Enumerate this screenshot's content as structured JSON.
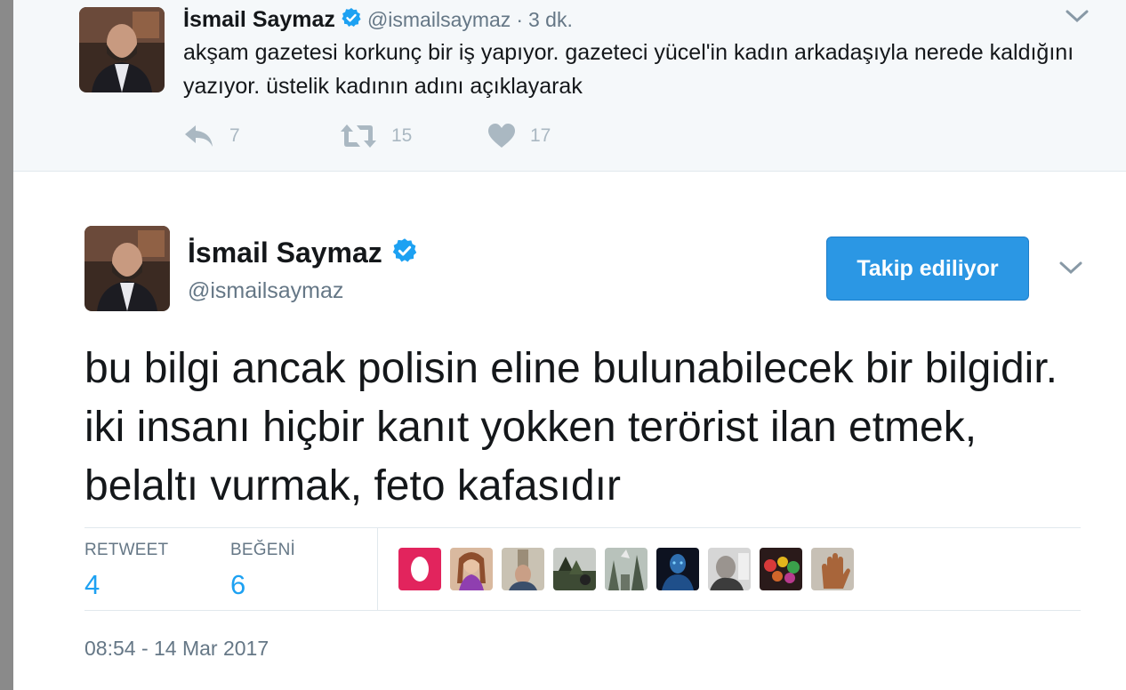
{
  "parent_tweet": {
    "name": "İsmail Saymaz",
    "handle": "@ismailsaymaz",
    "separator": "·",
    "time": "3 dk.",
    "text": "akşam gazetesi korkunç bir iş yapıyor. gazeteci yücel'in kadın arkadaşıyla nerede kaldığını yazıyor. üstelik kadının adını açıklayarak",
    "reply_count": "7",
    "retweet_count": "15",
    "like_count": "17"
  },
  "main_tweet": {
    "name": "İsmail Saymaz",
    "handle": "@ismailsaymaz",
    "follow_button": "Takip ediliyor",
    "text": "bu bilgi ancak polisin eline bulunabilecek bir bilgidir. iki insanı hiçbir kanıt yokken terörist ilan etmek, belaltı vurmak, feto kafasıdır",
    "retweet_label": "RETWEET",
    "retweet_count": "4",
    "like_label": "BEĞENİ",
    "like_count": "6",
    "timestamp": "08:54 - 14 Mar 2017"
  },
  "icons": {
    "verified": "verified-badge-icon",
    "reply": "reply-icon",
    "retweet": "retweet-icon",
    "like": "heart-icon",
    "caret": "chevron-down-icon"
  },
  "colors": {
    "accent": "#1da1f2",
    "button": "#2b97e4",
    "muted": "#657786",
    "action_gray": "#aab8c2",
    "parent_bg": "#f5f8fa"
  }
}
